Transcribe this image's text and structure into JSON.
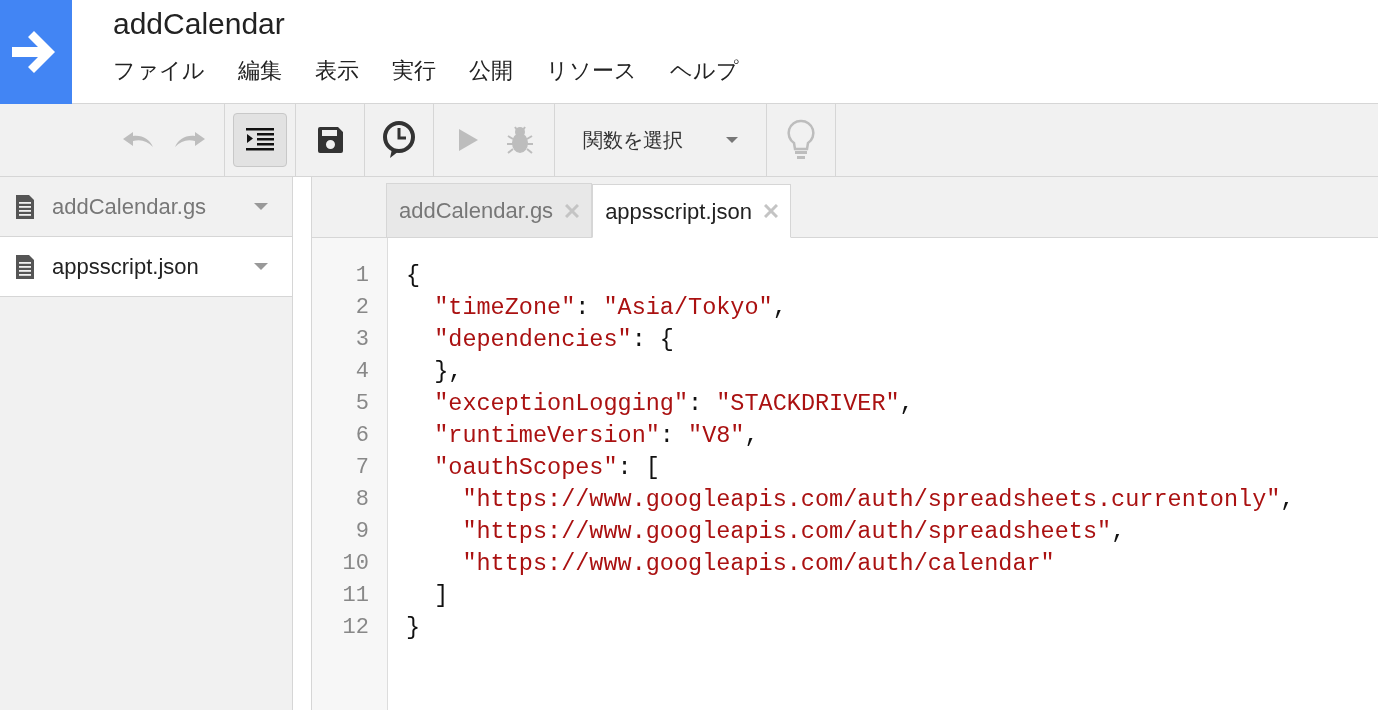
{
  "window": {
    "title": "addCalendar"
  },
  "menu": [
    "ファイル",
    "編集",
    "表示",
    "実行",
    "公開",
    "リソース",
    "ヘルプ"
  ],
  "toolbar": [
    {
      "kind": "undo",
      "disabled": true
    },
    {
      "kind": "redo",
      "disabled": true
    },
    {
      "kind": "indent",
      "on": true
    },
    {
      "kind": "save",
      "disabled": false
    },
    {
      "kind": "trigger",
      "disabled": false
    },
    {
      "kind": "run",
      "disabled": true
    },
    {
      "kind": "debug",
      "disabled": true
    },
    {
      "kind": "select",
      "label": "関数を選択"
    },
    {
      "kind": "bulb",
      "disabled": true
    }
  ],
  "sidebar": {
    "items": [
      {
        "label": "addCalendar.gs",
        "selected": false
      },
      {
        "label": "appsscript.json",
        "selected": true
      }
    ]
  },
  "tabs": [
    {
      "label": "addCalendar.gs",
      "selected": false
    },
    {
      "label": "appsscript.json",
      "selected": true
    }
  ],
  "editor": {
    "lines": [
      {
        "number": "1",
        "segments": [
          {
            "kind": "punct",
            "text": "{"
          }
        ]
      },
      {
        "number": "2",
        "segments": [
          {
            "kind": "string",
            "text": "  \"timeZone\""
          },
          {
            "kind": "punct",
            "text": ": "
          },
          {
            "kind": "string",
            "text": "\"Asia/Tokyo\""
          },
          {
            "kind": "punct",
            "text": ","
          }
        ]
      },
      {
        "number": "3",
        "segments": [
          {
            "kind": "string",
            "text": "  \"dependencies\""
          },
          {
            "kind": "punct",
            "text": ": {"
          }
        ]
      },
      {
        "number": "4",
        "segments": [
          {
            "kind": "punct",
            "text": "  },"
          }
        ]
      },
      {
        "number": "5",
        "segments": [
          {
            "kind": "string",
            "text": "  \"exceptionLogging\""
          },
          {
            "kind": "punct",
            "text": ": "
          },
          {
            "kind": "string",
            "text": "\"STACKDRIVER\""
          },
          {
            "kind": "punct",
            "text": ","
          }
        ]
      },
      {
        "number": "6",
        "segments": [
          {
            "kind": "string",
            "text": "  \"runtimeVersion\""
          },
          {
            "kind": "punct",
            "text": ": "
          },
          {
            "kind": "string",
            "text": "\"V8\""
          },
          {
            "kind": "punct",
            "text": ","
          }
        ]
      },
      {
        "number": "7",
        "segments": [
          {
            "kind": "string",
            "text": "  \"oauthScopes\""
          },
          {
            "kind": "punct",
            "text": ": ["
          }
        ]
      },
      {
        "number": "8",
        "segments": [
          {
            "kind": "string",
            "text": "    \"https://www.googleapis.com/auth/spreadsheets.currentonly\""
          },
          {
            "kind": "punct",
            "text": ","
          }
        ]
      },
      {
        "number": "9",
        "segments": [
          {
            "kind": "string",
            "text": "    \"https://www.googleapis.com/auth/spreadsheets\""
          },
          {
            "kind": "punct",
            "text": ","
          }
        ]
      },
      {
        "number": "10",
        "segments": [
          {
            "kind": "string",
            "text": "    \"https://www.googleapis.com/auth/calendar\""
          }
        ]
      },
      {
        "number": "11",
        "segments": [
          {
            "kind": "punct",
            "text": "  ]"
          }
        ]
      },
      {
        "number": "12",
        "segments": [
          {
            "kind": "punct",
            "text": "}"
          }
        ]
      }
    ]
  }
}
